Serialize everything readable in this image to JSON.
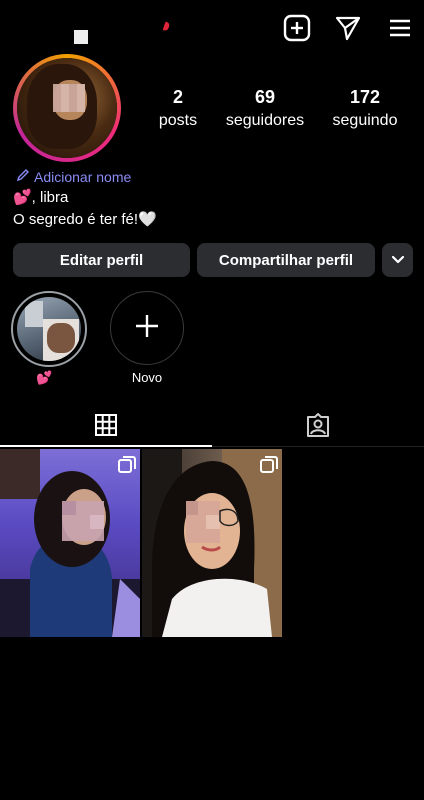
{
  "header": {
    "icons": [
      "new-post-icon",
      "direct-message-icon",
      "menu-icon"
    ]
  },
  "profile": {
    "stats": [
      {
        "value": "2",
        "label": "posts"
      },
      {
        "value": "69",
        "label": "seguidores"
      },
      {
        "value": "172",
        "label": "seguindo"
      }
    ],
    "add_name": "Adicionar nome",
    "bio_line1": "💕, libra",
    "bio_line2": "O segredo é ter fé!🤍"
  },
  "buttons": {
    "edit": "Editar perfil",
    "share": "Compartilhar perfil"
  },
  "highlights": [
    {
      "label": "💕"
    },
    {
      "label": "Novo"
    }
  ],
  "tabs": [
    {
      "name": "grid",
      "icon": "grid-icon",
      "active": true
    },
    {
      "name": "tagged",
      "icon": "tagged-person-icon",
      "active": false
    }
  ],
  "colors": {
    "accent_link": "#8a8cf5",
    "button_bg": "#2b2d31",
    "story_ring": [
      "#f2a100",
      "#ee2a7b",
      "#c1269a"
    ]
  }
}
